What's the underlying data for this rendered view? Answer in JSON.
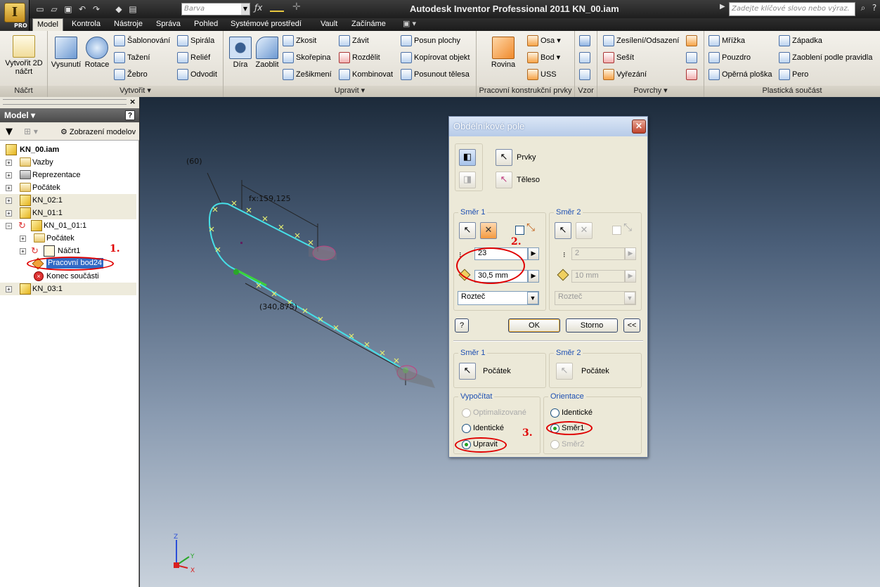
{
  "app": {
    "title": "Autodesk Inventor Professional 2011    KN_00.iam",
    "color_combo": "Barva",
    "search_placeholder": "Zadejte klíčové slovo nebo výraz.",
    "pro_badge": "PRO"
  },
  "tabs": [
    "Model",
    "Kontrola",
    "Nástroje",
    "Správa",
    "Pohled",
    "Systémové prostředí",
    "Vault",
    "Začínáme"
  ],
  "ribbon": {
    "sketch": {
      "button": "Vytvořit 2D náčrt",
      "label": "Náčrt"
    },
    "create": {
      "extrude": "Vysunutí",
      "revolve": "Rotace",
      "items": [
        "Šablonování",
        "Tažení",
        "Žebro",
        "Spirála",
        "Reliéf",
        "Odvodit"
      ],
      "label": "Vytvořit"
    },
    "modify": {
      "hole": "Díra",
      "fillet": "Zaoblit",
      "items": [
        "Zkosit",
        "Skořepina",
        "Zešikmení",
        "Závit",
        "Rozdělit",
        "Kombinovat",
        "Posun plochy",
        "Kopírovat objekt",
        "Posunout tělesa"
      ],
      "label": "Upravit"
    },
    "workfeatures": {
      "plane": "Rovina",
      "items": [
        "Osa",
        "Bod",
        "USS"
      ],
      "label": "Pracovní konstrukční prvky"
    },
    "pattern": {
      "label": "Vzor"
    },
    "surface": {
      "items": [
        "Zesílení/Odsazení",
        "Sešít",
        "Vyřezání"
      ],
      "label": "Povrchy"
    },
    "plastic": {
      "items": [
        "Mřížka",
        "Pouzdro",
        "Opěrná ploška",
        "Západka",
        "Zaoblení podle pravidla",
        "Pero"
      ],
      "label": "Plastická součást"
    }
  },
  "browser": {
    "title": "Model",
    "view_label": "Zobrazení modelov",
    "rows": [
      {
        "label": "KN_00.iam"
      },
      {
        "label": "Vazby"
      },
      {
        "label": "Reprezentace"
      },
      {
        "label": "Počátek"
      },
      {
        "label": "KN_02:1"
      },
      {
        "label": "KN_01:1"
      },
      {
        "label": "KN_01_01:1"
      },
      {
        "label": "Počátek"
      },
      {
        "label": "Náčrt1"
      },
      {
        "label": "Pracovní bod24"
      },
      {
        "label": "Konec součásti"
      },
      {
        "label": "KN_03:1"
      }
    ]
  },
  "viewport": {
    "dim_angle": "(60)",
    "dim_fx": "fx:159,125",
    "dim_length": "(340,875)"
  },
  "dialog": {
    "title": "Obdélníkové pole",
    "features_label": "Prvky",
    "body_label": "Těleso",
    "dir1": {
      "label": "Směr 1",
      "count": "23",
      "distance": "30,5 mm",
      "method": "Rozteč"
    },
    "dir2": {
      "label": "Směr 2",
      "count": "2",
      "distance": "10 mm",
      "method": "Rozteč"
    },
    "ok": "OK",
    "cancel": "Storno",
    "more": "<<",
    "start1": {
      "label": "Směr 1",
      "value": "Počátek"
    },
    "start2": {
      "label": "Směr 2",
      "value": "Počátek"
    },
    "compute": {
      "label": "Vypočítat",
      "options": [
        "Optimalizované",
        "Identické",
        "Upravit"
      ],
      "selected": "Upravit"
    },
    "orientation": {
      "label": "Orientace",
      "options": [
        "Identické",
        "Směr1",
        "Směr2"
      ],
      "selected": "Směr1"
    }
  },
  "annotations": {
    "a1": "1.",
    "a2": "2.",
    "a3": "3."
  },
  "colors": {
    "annotation": "#e00000",
    "path": "#46e0e8",
    "selected_path": "#3bd23b",
    "title_blue": "#1d4fb2"
  }
}
